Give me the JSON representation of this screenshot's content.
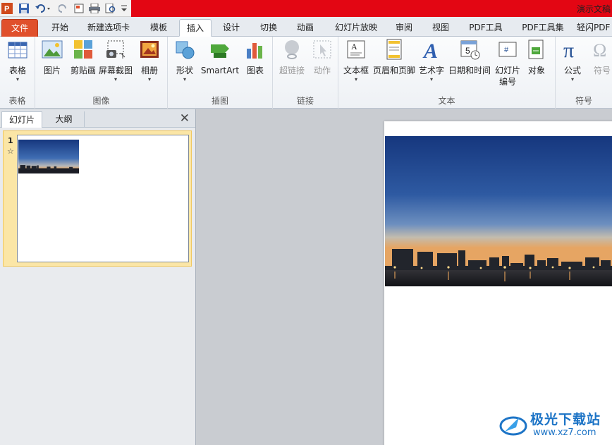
{
  "window": {
    "title": "演示文稿"
  },
  "quick_access": {
    "icons": [
      "ppt-logo-icon",
      "save-icon",
      "undo-icon",
      "redo-icon",
      "new-icon",
      "print-icon",
      "preview-icon",
      "customize-icon"
    ]
  },
  "tabs": [
    {
      "label": "文件"
    },
    {
      "label": "开始"
    },
    {
      "label": "新建选项卡"
    },
    {
      "label": "模板"
    },
    {
      "label": "插入"
    },
    {
      "label": "设计"
    },
    {
      "label": "切换"
    },
    {
      "label": "动画"
    },
    {
      "label": "幻灯片放映"
    },
    {
      "label": "审阅"
    },
    {
      "label": "视图"
    },
    {
      "label": "PDF工具"
    },
    {
      "label": "PDF工具集"
    },
    {
      "label": "轻闪PDF"
    }
  ],
  "active_tab": "插入",
  "ribbon": {
    "groups": {
      "table": "表格",
      "images": "图像",
      "illustrations": "插图",
      "links": "链接",
      "text": "文本",
      "symbols": "符号"
    },
    "buttons": {
      "table": "表格",
      "picture": "图片",
      "clipart": "剪贴画",
      "screenshot": "屏幕截图",
      "album": "相册",
      "shapes": "形状",
      "smartart": "SmartArt",
      "chart": "图表",
      "hyperlink": "超链接",
      "action": "动作",
      "textbox": "文本框",
      "header_footer": "页眉和页脚",
      "wordart": "艺术字",
      "datetime": "日期和时间",
      "slide_number_1": "幻灯片",
      "slide_number_2": "编号",
      "object": "对象",
      "equation": "公式",
      "symbol": "符号"
    }
  },
  "panel": {
    "tab_slides": "幻灯片",
    "tab_outline": "大纲",
    "slide_number": "1",
    "slide_star": "☆"
  },
  "watermark": {
    "brand": "极光下载站",
    "url": "www.xz7.com"
  },
  "colors": {
    "accent_red": "#e30613",
    "file_tab": "#e0502c",
    "selected_slide": "#fbe6a6"
  }
}
